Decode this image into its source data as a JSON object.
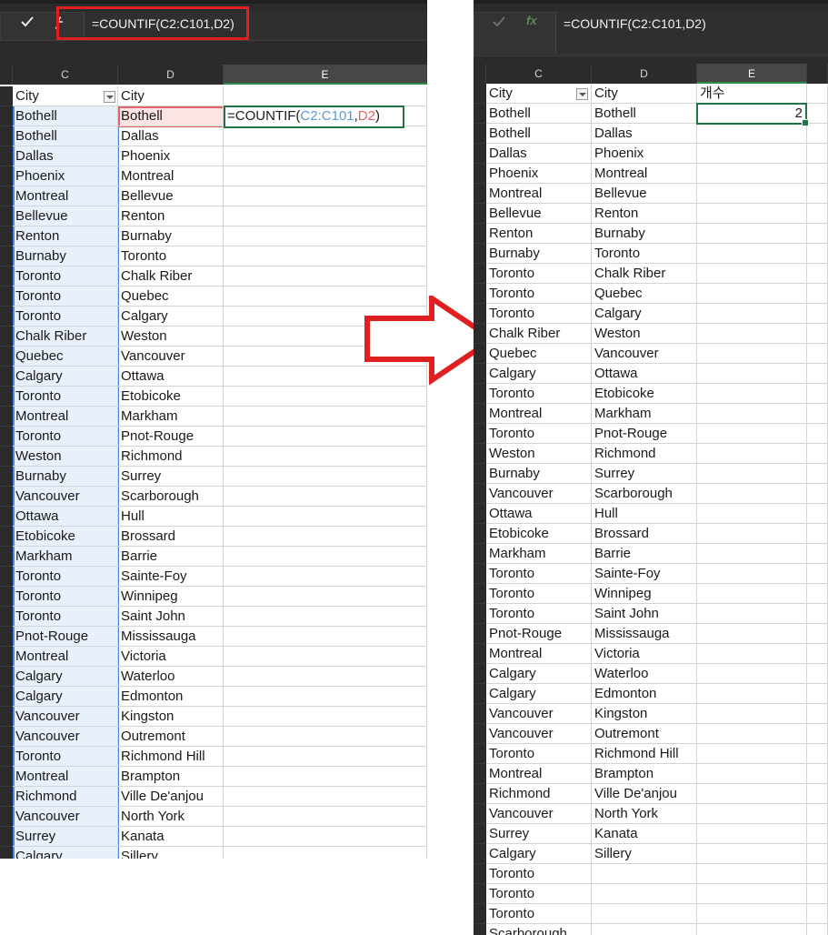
{
  "left": {
    "formula_bar": {
      "cancel_icon": "x-icon",
      "enter_icon": "check-icon",
      "fx_icon": "fx-icon",
      "formula": "=COUNTIF(C2:C101,D2)"
    },
    "columns": [
      "C",
      "D",
      "E"
    ],
    "header": {
      "c": "City",
      "d": "City",
      "e": ""
    },
    "edit_cell": {
      "prefix": "=COUNTIF(",
      "range": "C2:C101",
      "comma": ",",
      "criteria": "D2",
      "suffix": ")",
      "range_color": "#5b9bd5",
      "criteria_color": "#e06666"
    },
    "c_values": [
      "Bothell",
      "Bothell",
      "Dallas",
      "Phoenix",
      "Montreal",
      "Bellevue",
      "Renton",
      "Burnaby",
      "Toronto",
      "Toronto",
      "Toronto",
      "Chalk Riber",
      "Quebec",
      "Calgary",
      "Toronto",
      "Montreal",
      "Toronto",
      "Weston",
      "Burnaby",
      "Vancouver",
      "Ottawa",
      "Etobicoke",
      "Markham",
      "Toronto",
      "Toronto",
      "Toronto",
      "Pnot-Rouge",
      "Montreal",
      "Calgary",
      "Calgary",
      "Vancouver",
      "Vancouver",
      "Toronto",
      "Montreal",
      "Richmond",
      "Vancouver",
      "Surrey",
      "Calgary"
    ],
    "d_values": [
      "Bothell",
      "Dallas",
      "Phoenix",
      "Montreal",
      "Bellevue",
      "Renton",
      "Burnaby",
      "Toronto",
      "Chalk Riber",
      "Quebec",
      "Calgary",
      "Weston",
      "Vancouver",
      "Ottawa",
      "Etobicoke",
      "Markham",
      "Pnot-Rouge",
      "Richmond",
      "Surrey",
      "Scarborough",
      "Hull",
      "Brossard",
      "Barrie",
      "Sainte-Foy",
      "Winnipeg",
      "Saint John",
      "Mississauga",
      "Victoria",
      "Waterloo",
      "Edmonton",
      "Kingston",
      "Outremont",
      "Richmond Hill",
      "Brampton",
      "Ville De'anjou",
      "North York",
      "Kanata",
      "Sillery"
    ]
  },
  "right": {
    "formula_bar": {
      "enter_icon": "check-icon",
      "fx_icon": "fx-icon",
      "fx_label": "fx",
      "formula": "=COUNTIF(C2:C101,D2)"
    },
    "columns": [
      "C",
      "D",
      "E"
    ],
    "header": {
      "c": "City",
      "d": "City",
      "e": "개수"
    },
    "result": "2",
    "c_values": [
      "Bothell",
      "Bothell",
      "Dallas",
      "Phoenix",
      "Montreal",
      "Bellevue",
      "Renton",
      "Burnaby",
      "Toronto",
      "Toronto",
      "Toronto",
      "Chalk Riber",
      "Quebec",
      "Calgary",
      "Toronto",
      "Montreal",
      "Toronto",
      "Weston",
      "Burnaby",
      "Vancouver",
      "Ottawa",
      "Etobicoke",
      "Markham",
      "Toronto",
      "Toronto",
      "Toronto",
      "Pnot-Rouge",
      "Montreal",
      "Calgary",
      "Calgary",
      "Vancouver",
      "Vancouver",
      "Toronto",
      "Montreal",
      "Richmond",
      "Vancouver",
      "Surrey",
      "Calgary",
      "Toronto",
      "Toronto",
      "Toronto",
      "Scarborough"
    ],
    "d_values": [
      "Bothell",
      "Dallas",
      "Phoenix",
      "Montreal",
      "Bellevue",
      "Renton",
      "Burnaby",
      "Toronto",
      "Chalk Riber",
      "Quebec",
      "Calgary",
      "Weston",
      "Vancouver",
      "Ottawa",
      "Etobicoke",
      "Markham",
      "Pnot-Rouge",
      "Richmond",
      "Surrey",
      "Scarborough",
      "Hull",
      "Brossard",
      "Barrie",
      "Sainte-Foy",
      "Winnipeg",
      "Saint John",
      "Mississauga",
      "Victoria",
      "Waterloo",
      "Edmonton",
      "Kingston",
      "Outremont",
      "Richmond Hill",
      "Brampton",
      "Ville De'anjou",
      "North York",
      "Kanata",
      "Sillery"
    ]
  },
  "arrow": {
    "icon": "right-arrow-icon",
    "stroke_color": "#e02020"
  },
  "colors": {
    "selection_green": "#217346",
    "dark_ui": "#2b2b2b"
  }
}
